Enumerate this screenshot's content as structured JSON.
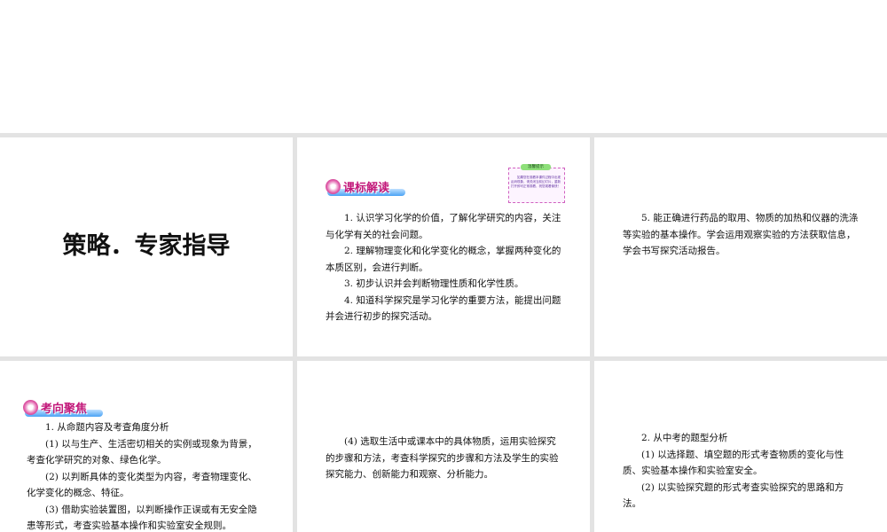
{
  "slides": {
    "s1": {
      "title": "策略．专家指导"
    },
    "s2": {
      "banner": "课标解读",
      "tip_label": "温馨提示",
      "tip_text": "如果您在观看本课件过程中出现乱码现象，请关闭当前幻灯片，重新打开即可正常观看，祝您观看愉快！",
      "paragraphs": [
        "1. 认识学习化学的价值，了解化学研究的内容，关注与化学有关的社会问题。",
        "2. 理解物理变化和化学变化的概念，掌握两种变化的本质区别，会进行判断。",
        "3. 初步认识并会判断物理性质和化学性质。",
        "4. 知道科学探究是学习化学的重要方法，能提出问题并会进行初步的探究活动。"
      ]
    },
    "s3": {
      "paragraphs": [
        "5. 能正确进行药品的取用、物质的加热和仪器的洗涤等实验的基本操作。学会运用观察实验的方法获取信息，学会书写探究活动报告。"
      ]
    },
    "s4": {
      "banner": "考向聚焦",
      "paragraphs": [
        "1. 从命题内容及考查角度分析",
        "(1) 以与生产、生活密切相关的实例或现象为背景，考查化学研究的对象、绿色化学。",
        "(2) 以判断具体的变化类型为内容，考查物理变化、化学变化的概念、特征。",
        "(3) 借助实验装置图，以判断操作正误或有无安全隐患等形式，考查实验基本操作和实验室安全规则。"
      ]
    },
    "s5": {
      "paragraphs": [
        "(4) 选取生活中或课本中的具体物质，运用实验探究的步骤和方法，考查科学探究的步骤和方法及学生的实验探究能力、创新能力和观察、分析能力。"
      ]
    },
    "s6": {
      "paragraphs": [
        "2. 从中考的题型分析",
        "(1) 以选择题、填空题的形式考查物质的变化与性质、实验基本操作和实验室安全。",
        "(2) 以实验探究题的形式考查实验探究的思路和方法。"
      ]
    }
  }
}
